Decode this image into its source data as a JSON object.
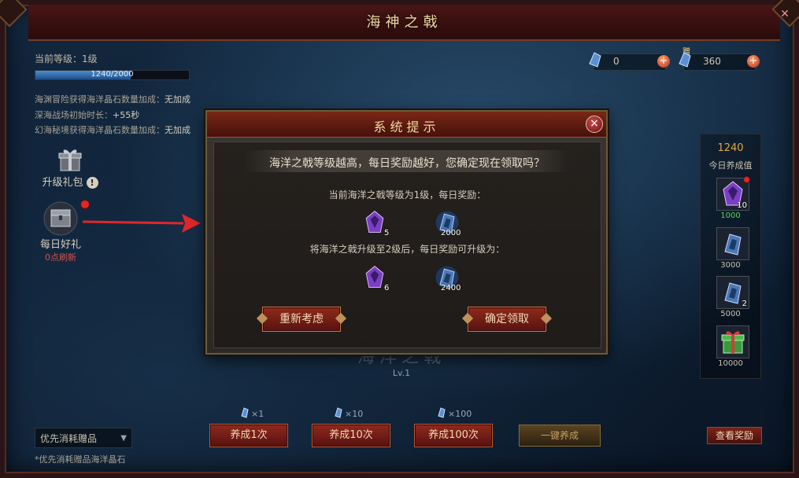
{
  "window": {
    "title": "海神之戟"
  },
  "level": {
    "label": "当前等级：1级",
    "xp_text": "1240/2000",
    "xp_progress": 0.62
  },
  "bonuses": [
    {
      "text": "海渊冒险获得海洋晶石数量加成：",
      "value": "无加成"
    },
    {
      "text": "深海战场初始时长：",
      "value": "+55秒"
    },
    {
      "text": "幻海秘境获得海洋晶石数量加成：",
      "value": "无加成"
    }
  ],
  "upgrade_gift": {
    "label": "升级礼包",
    "info_glyph": "!"
  },
  "daily_gift": {
    "label": "每日好礼",
    "refresh": "0点刷新"
  },
  "currencies": {
    "crystal_amount": "0",
    "gift_crystal_amount": "360",
    "gift_tag": "赠",
    "plus": "+"
  },
  "side_panel": {
    "today_value": "1240",
    "today_label": "今日养成值",
    "rewards": [
      {
        "count": "10",
        "threshold": "1000",
        "icon": "purple-crystal-icon"
      },
      {
        "count": "",
        "threshold": "3000",
        "icon": "blue-crystal-icon"
      },
      {
        "count": "2",
        "threshold": "5000",
        "icon": "blue-crystal-icon"
      },
      {
        "count": "",
        "threshold": "10000",
        "icon": "gift-box-icon"
      }
    ]
  },
  "weapon": {
    "title": "海洋之戟",
    "level": "Lv.1"
  },
  "cultivate": [
    {
      "cost": "×1",
      "label": "养成1次"
    },
    {
      "cost": "×10",
      "label": "养成10次"
    },
    {
      "cost": "×100",
      "label": "养成100次"
    }
  ],
  "onekey": {
    "label": "一键养成"
  },
  "view_reward": {
    "label": "查看奖励"
  },
  "priority": {
    "selected": "优先消耗赠品",
    "note": "*优先消耗赠品海洋晶石"
  },
  "modal": {
    "title": "系统提示",
    "close": "×",
    "question": "海洋之戟等级越高，每日奖励越好，您确定现在领取吗？",
    "current_line": "当前海洋之戟等级为1级，每日奖励：",
    "current_items": [
      {
        "icon": "purple-crystal-icon",
        "qty": "5"
      },
      {
        "icon": "blue-crystal-icon",
        "qty": "2000"
      }
    ],
    "upgrade_line": "将海洋之戟升级至2级后，每日奖励可升级为：",
    "upgrade_items": [
      {
        "icon": "purple-crystal-icon",
        "qty": "6"
      },
      {
        "icon": "blue-crystal-icon",
        "qty": "2400"
      }
    ],
    "reconsider": "重新考虑",
    "confirm": "确定领取"
  },
  "colors": {
    "accent_red": "#e0272a",
    "gold": "#e2a64a",
    "modal_header": "#7a2616"
  }
}
